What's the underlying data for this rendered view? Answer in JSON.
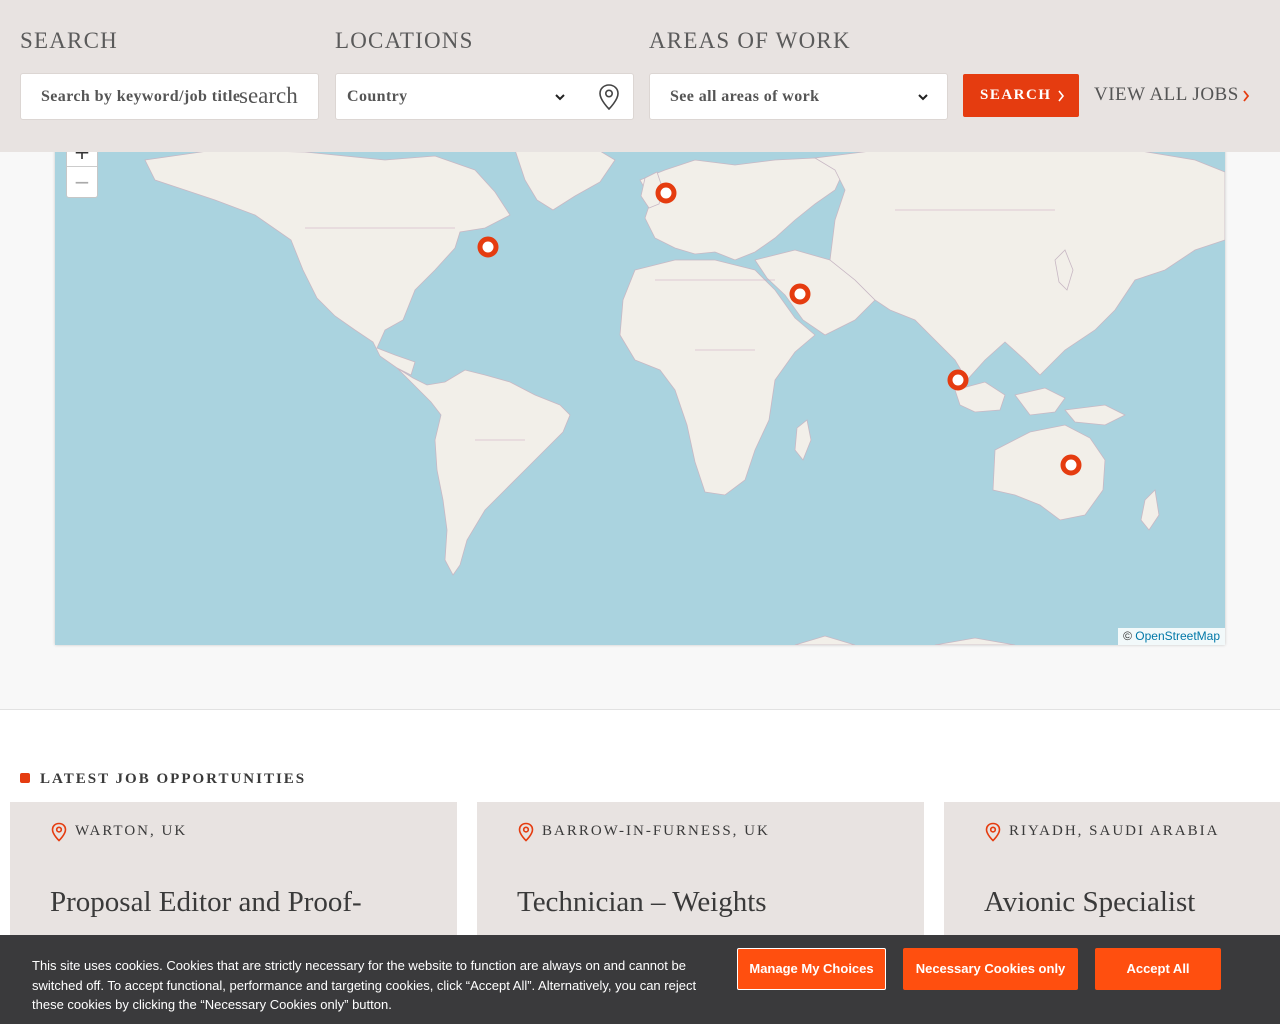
{
  "search": {
    "search_label": "SEARCH",
    "keyword_placeholder": "Search by keyword/job title",
    "keyword_icon_text": "search",
    "locations_label": "LOCATIONS",
    "country_value": "Country",
    "areas_label": "AREAS OF WORK",
    "areas_value": "See all areas of work",
    "search_button": "SEARCH",
    "view_all": "VIEW ALL JOBS"
  },
  "map": {
    "zoom_in": "+",
    "zoom_out": "−",
    "attribution_prefix": "©",
    "attribution_link": "OpenStreetMap",
    "markers": [
      "uk",
      "us-east",
      "saudi-arabia",
      "singapore",
      "australia"
    ]
  },
  "jobs": {
    "section_title": "LATEST JOB OPPORTUNITIES",
    "cards": [
      {
        "location": "WARTON, UK",
        "title": "Proposal Editor and Proof-"
      },
      {
        "location": "BARROW-IN-FURNESS, UK",
        "title": "Technician – Weights"
      },
      {
        "location": "RIYADH, SAUDI ARABIA",
        "title": "Avionic Specialist"
      }
    ]
  },
  "cookie": {
    "text": "This site uses cookies. Cookies that are strictly necessary for the website to function are always on and cannot be switched off. To accept functional, performance and targeting cookies, click “Accept All”. Alternatively, you can reject these cookies by clicking the “Necessary Cookies only” button.",
    "manage": "Manage My Choices",
    "necessary": "Necessary Cookies only",
    "accept": "Accept All"
  },
  "colors": {
    "accent": "#e53c10",
    "panel": "#e8e3e1",
    "ocean": "#aad3df",
    "land": "#f2efe9",
    "cookie_bg": "#3a3a3c"
  }
}
